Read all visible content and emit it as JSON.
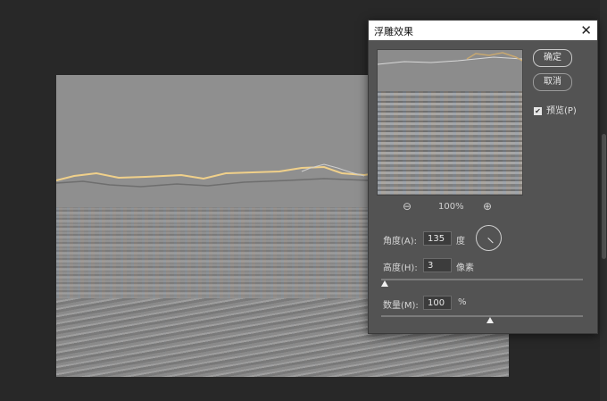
{
  "dialog": {
    "title": "浮雕效果",
    "ok_label": "确定",
    "cancel_label": "取消",
    "preview_label": "预览(P)",
    "preview_checked": true,
    "zoom": "100%",
    "angle": {
      "label": "角度(A):",
      "value": "135",
      "unit": "度"
    },
    "height": {
      "label": "高度(H):",
      "value": "3",
      "unit": "像素"
    },
    "amount": {
      "label": "数量(M):",
      "value": "100",
      "unit": "%"
    }
  },
  "colors": {
    "workspace": "#282828",
    "dialog_bg": "#535353",
    "titlebar_bg": "#ffffff"
  },
  "icons": {
    "close": "close-icon",
    "zoom_out": "zoom-out-icon",
    "zoom_in": "zoom-in-icon",
    "checkbox": "checkbox-checked-icon",
    "angle_dial": "angle-dial-icon"
  }
}
